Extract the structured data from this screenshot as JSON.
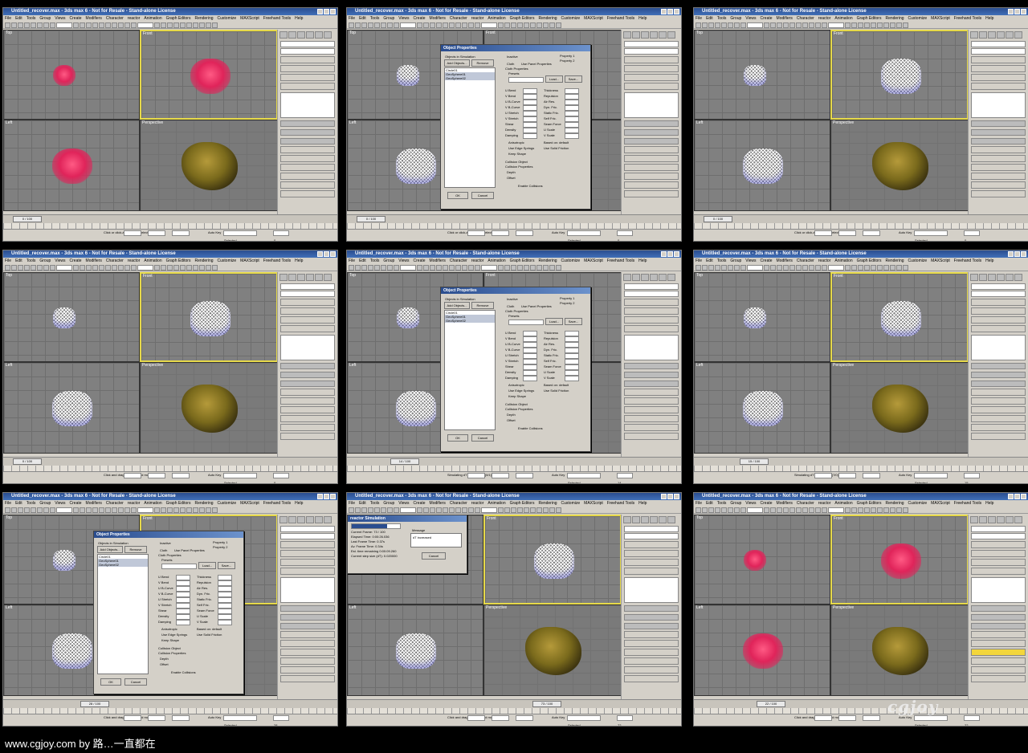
{
  "window": {
    "title": "Untitled_recover.max - 3ds max 6 - Not for Resale - Stand-alone License",
    "menu": [
      "File",
      "Edit",
      "Tools",
      "Group",
      "Views",
      "Create",
      "Modifiers",
      "Character",
      "reactor",
      "Animation",
      "Graph Editors",
      "Rendering",
      "Customize",
      "MAXScript",
      "Freehand Tools",
      "Help"
    ],
    "toolbar_select": "All",
    "toolbar_view": "View"
  },
  "viewports": {
    "top": "Top",
    "front": "Front",
    "left": "Left",
    "perspective": "Perspective"
  },
  "frames": [
    {
      "time": "0 / 100",
      "status": "Click or click-and-drag to select objects",
      "tag": "Add Time Tag",
      "autokey": "Auto Key",
      "selected": "Selected",
      "setkey": "Set Key",
      "filters": "Key Filters...",
      "panel": "Object Type",
      "frame": "0"
    },
    {
      "time": "0 / 100",
      "status": "Click or click-and-drag to select objects",
      "tag": "Add Time Tag",
      "autokey": "Auto Key",
      "selected": "Selected",
      "setkey": "Set Key",
      "filters": "Key Filters...",
      "panel": "Modifier List",
      "frame": "0"
    },
    {
      "time": "0 / 100",
      "status": "Click or click-and-drag to select objects",
      "tag": "Add Time Tag",
      "autokey": "Auto Key",
      "selected": "Selected",
      "setkey": "Set Key",
      "filters": "Key Filters...",
      "panel": "Modifier List",
      "frame": "0"
    },
    {
      "time": "0 / 100",
      "status": "Click and drag to select and move",
      "tag": "Add Time Tag",
      "autokey": "Auto Key",
      "selected": "Selected",
      "setkey": "Set Key",
      "filters": "Key Filters...",
      "panel": "Modifier List",
      "frame": "0"
    },
    {
      "time": "14 / 100",
      "status": "Simulating dT = 0.020000 (0/1)",
      "tag": "Add Time Tag",
      "autokey": "Auto Key",
      "selected": "Selected",
      "setkey": "Set Key",
      "filters": "Key Filters...",
      "panel": "Modifier List",
      "frame": "14"
    },
    {
      "time": "15 / 100",
      "status": "Simulating dT = 0.020000 (7/0)",
      "tag": "Add Time Tag",
      "autokey": "Auto Key",
      "selected": "Selected",
      "setkey": "Set Key",
      "filters": "Key Filters...",
      "panel": "Modifier List",
      "frame": "15"
    },
    {
      "time": "28 / 100",
      "status": "Click and drag to select and move",
      "tag": "Add Time Tag",
      "autokey": "Auto Key",
      "selected": "Selected",
      "setkey": "Set Key",
      "filters": "Key Filters...",
      "panel": "Modifier List",
      "frame": "28"
    },
    {
      "time": "73 / 100",
      "status": "Click and drag to select and move",
      "tag": "Add Time Tag",
      "autokey": "Auto Key",
      "selected": "Selected",
      "setkey": "Set Key",
      "filters": "Key Filters...",
      "panel": "Modifier List",
      "frame": "72"
    },
    {
      "time": "22 / 100",
      "status": "Click and drag to select and move",
      "tag": "Add Time Tag",
      "autokey": "Auto Key",
      "selected": "Selected",
      "setkey": "Set Key",
      "filters": "Key Filters...",
      "panel": "Modifier List",
      "frame": "22"
    }
  ],
  "dialog": {
    "title": "Object Properties",
    "objects_label": "Objects in Simulation",
    "add": "Add Objects...",
    "remove": "Remove",
    "items": [
      "Circle01",
      "GeoSphere01",
      "GeoSphere02"
    ],
    "inactive": "Inactive",
    "cloth": "Cloth",
    "use_panel": "Use Panel Properties",
    "property1": "Property 1",
    "property2": "Property 2",
    "cloth_properties": "Cloth Properties",
    "presets": "Presets",
    "load": "Load...",
    "save": "Save...",
    "params_left": [
      "U Bend",
      "V Bend",
      "U B-Curve",
      "V B-Curve",
      "U Stretch",
      "V Stretch",
      "Shear",
      "Density",
      "Damping"
    ],
    "params_right": [
      "Thickness",
      "Repulsion",
      "Air Res.",
      "Dyn. Fric.",
      "Static Fric.",
      "Self Fric.",
      "Seam Force",
      "U Scale",
      "V Scale"
    ],
    "anisotropic": "Anisotropic",
    "edge_springs": "Use Edge Springs",
    "solid_friction": "Use Solid Friction",
    "keep_shape": "Keep Shape",
    "based_on": "Based on: default",
    "collision": "Collision Object",
    "collision_props": "Collision Properties",
    "depth": "Depth",
    "offset": "Offset",
    "enable_collisions": "Enable Collisions",
    "ok": "OK",
    "cancel": "Cancel"
  },
  "progress": {
    "title": "reactor Simulation",
    "current_frame": "Current Frame: 73 / 100",
    "elapsed": "Elapsed Time: 0:00:26.036",
    "last": "Last Frame Time: 0.37s",
    "avg": "Av. Frame Time: 0.34s",
    "remaining": "Est. time remaining 0:00:09.260",
    "step": "Current step size (dT): 0.020000",
    "message_label": "Message",
    "message": "dT increased",
    "cancel": "Cancel"
  },
  "panel_buttons": {
    "edit_mesh": "Edit Mesh",
    "edit_spline": "Edit Spline",
    "mesh_select": "Mesh Select",
    "relax": "Relax",
    "hsds": "HSDS",
    "shell": "Shell",
    "clothfx": "clothfx",
    "intersect": "Intersect",
    "simulation": "Simulation",
    "simulate_local": "Simulate Local",
    "simulate_local_damped": "Simulate Local (damped)",
    "simulate": "Simulate",
    "progress_label": "Progress",
    "simulated_frames": "Simulated Frames:",
    "erase": "Erase Simulation",
    "truncate": "Truncate Simulation",
    "object": "Object",
    "object_props": "Object Properties",
    "dynamic_effects": "Dynamic Effects",
    "object_type": "Object Type",
    "autogrid": "AutoGrid",
    "name_color": "Name and Color",
    "primitives": [
      "Box",
      "Cone",
      "Sphere",
      "GeoSphere",
      "Cylinder",
      "Tube",
      "Torus",
      "Pyramid",
      "Teapot",
      "Plane"
    ],
    "geosphere_name": "GeoSphere02",
    "circle_name": "Circle01",
    "standard_primitives": "Standard Primitives",
    "stack": [
      "clothfx",
      "Group",
      "Panel",
      "Seams",
      "Faces"
    ]
  },
  "colors": {
    "accent": "#e6d94a",
    "object_red": "#e0245a",
    "wire_white": "#ffffff",
    "cloth_gold": "#7a6a1c",
    "title_blue": "#2a4d8f"
  },
  "footer": {
    "text": "www.cgjoy.com by 路…一直都在",
    "watermark": "cgjoy"
  }
}
